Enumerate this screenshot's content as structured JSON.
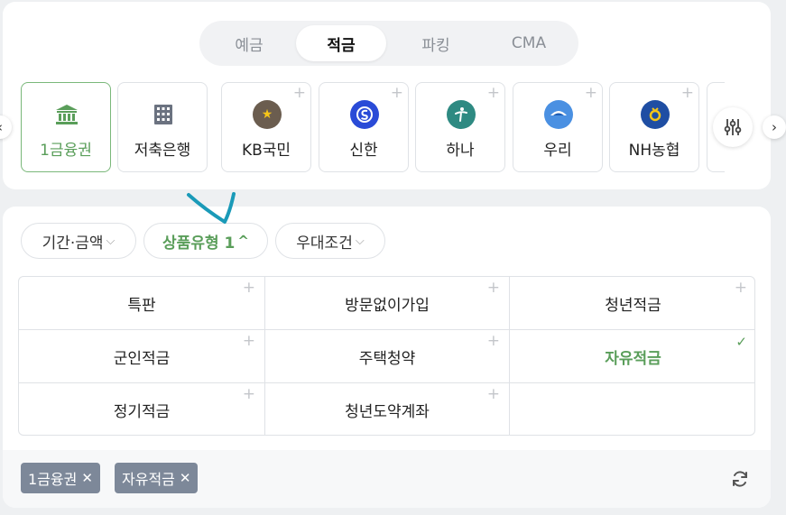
{
  "tabs": [
    "예금",
    "적금",
    "파킹",
    "CMA"
  ],
  "active_tab": "적금",
  "banks": [
    {
      "label": "1금융권",
      "icon": "bank-building-icon",
      "selected": true
    },
    {
      "label": "저축은행",
      "icon": "office-building-icon",
      "selected": false
    },
    {
      "label": "KB국민",
      "icon": "kb-logo-icon",
      "selected": false
    },
    {
      "label": "신한",
      "icon": "shinhan-logo-icon",
      "selected": false
    },
    {
      "label": "하나",
      "icon": "hana-logo-icon",
      "selected": false
    },
    {
      "label": "우리",
      "icon": "woori-logo-icon",
      "selected": false
    },
    {
      "label": "NH농협",
      "icon": "nh-logo-icon",
      "selected": false
    }
  ],
  "filters": {
    "period_amount": "기간·금액",
    "product_type": "상품유형 1",
    "benefit": "우대조건"
  },
  "product_types": [
    {
      "label": "특판",
      "checked": false
    },
    {
      "label": "방문없이가입",
      "checked": false
    },
    {
      "label": "청년적금",
      "checked": false
    },
    {
      "label": "군인적금",
      "checked": false
    },
    {
      "label": "주택청약",
      "checked": false
    },
    {
      "label": "자유적금",
      "checked": true
    },
    {
      "label": "정기적금",
      "checked": false
    },
    {
      "label": "청년도약계좌",
      "checked": false
    }
  ],
  "selected_tags": [
    "1금융권",
    "자유적금"
  ],
  "colors": {
    "accent": "#5a9e5a",
    "tag_bg": "#7d8899",
    "annotation": "#1a9ab8"
  }
}
